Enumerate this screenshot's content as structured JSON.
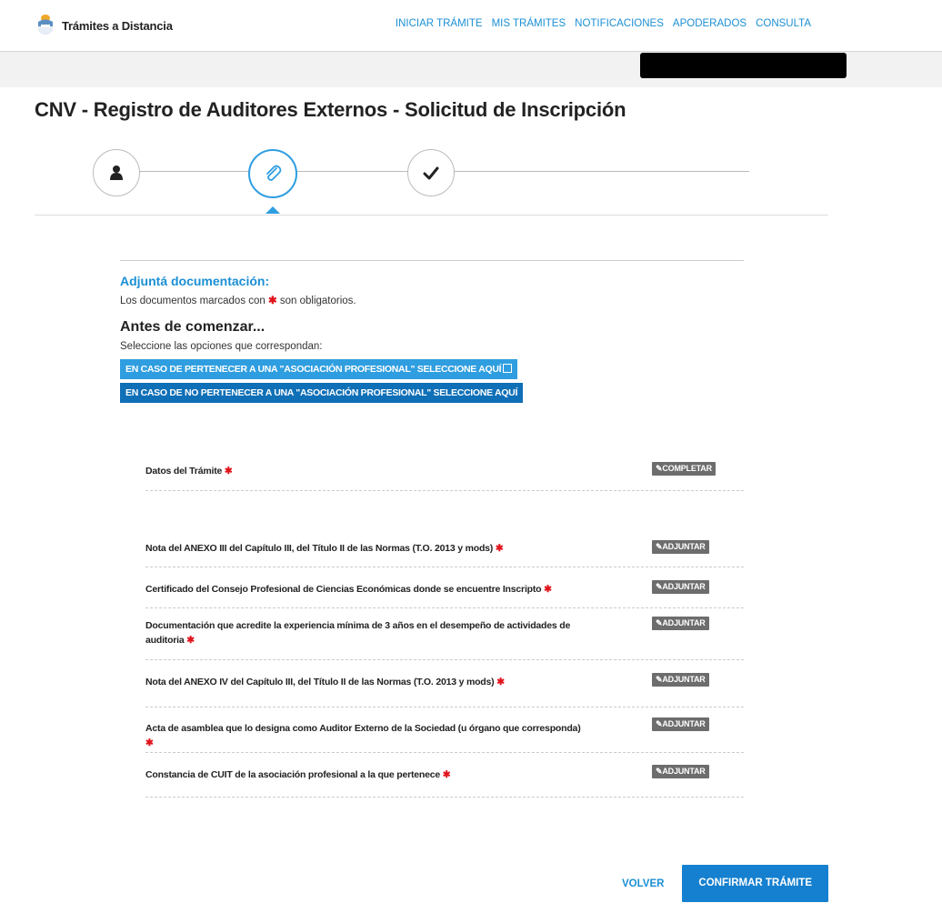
{
  "header": {
    "brand": "Trámites a Distancia",
    "nav": [
      "INICIAR TRÁMITE",
      "MIS TRÁMITES",
      "NOTIFICACIONES",
      "APODERADOS",
      "CONSULTA"
    ]
  },
  "page": {
    "title": "CNV - Registro de Auditores Externos - Solicitud de Inscripción"
  },
  "stepper": {
    "steps": [
      {
        "icon": "user-icon",
        "active": false
      },
      {
        "icon": "paperclip-icon",
        "active": true
      },
      {
        "icon": "check-icon",
        "active": false
      }
    ]
  },
  "section": {
    "heading": "Adjuntá documentación:",
    "note_prefix": "Los documentos marcados con",
    "note_suffix": "son obligatorios.",
    "before_title": "Antes de comenzar...",
    "before_sub": "Seleccione las opciones que correspondan:",
    "option1": "EN CASO DE PERTENECER A UNA \"ASOCIACIÓN PROFESIONAL\" SELECCIONE AQUÍ",
    "option2": "EN CASO DE NO PERTENECER A UNA \"ASOCIACIÓN PROFESIONAL\" SELECCIONE AQUÍ",
    "required_mark": "✱"
  },
  "documents": [
    {
      "label": "Datos del Trámite",
      "action": "COMPLETAR",
      "action_icon": "pencil-icon"
    },
    {
      "label": "Nota del ANEXO III del Capítulo III, del Título II de las Normas (T.O. 2013 y mods)",
      "action": "ADJUNTAR",
      "action_icon": "tag-icon"
    },
    {
      "label": "Certificado del Consejo Profesional de Ciencias Económicas donde se encuentre Inscripto",
      "action": "ADJUNTAR",
      "action_icon": "tag-icon"
    },
    {
      "label": "Documentación que acredite la experiencia mínima de 3 años en el desempeño de actividades de auditoria",
      "action": "ADJUNTAR",
      "action_icon": "tag-icon"
    },
    {
      "label": "Nota del ANEXO IV del Capítulo III, del Título II de las Normas (T.O. 2013 y mods)",
      "action": "ADJUNTAR",
      "action_icon": "tag-icon"
    },
    {
      "label": "Acta de asamblea que lo designa como Auditor Externo de la Sociedad (u órgano que corresponda)",
      "action": "ADJUNTAR",
      "action_icon": "tag-icon"
    },
    {
      "label": "Constancia de CUIT de la asociación profesional a la que pertenece",
      "action": "ADJUNTAR",
      "action_icon": "tag-icon"
    }
  ],
  "footer": {
    "back": "VOLVER",
    "confirm": "CONFIRMAR TRÁMITE"
  },
  "colors": {
    "accent": "#1b8fd4",
    "required": "#e1131b",
    "tag": "#6d6d6d"
  }
}
